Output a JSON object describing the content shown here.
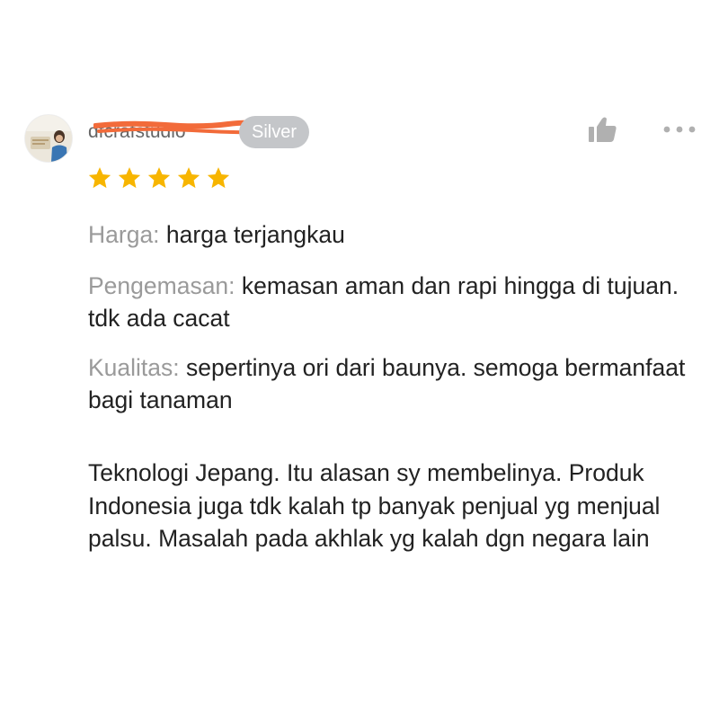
{
  "reviewer": {
    "username": "dfcrafstudio",
    "badge": "Silver"
  },
  "rating": {
    "stars": 5,
    "max": 5,
    "star_color": "#f7b500"
  },
  "fields": [
    {
      "label": "Harga:",
      "value": "harga terjangkau"
    },
    {
      "label": "Pengemasan:",
      "value": "kemasan aman dan rapi hingga di tujuan. tdk ada cacat"
    },
    {
      "label": "Kualitas:",
      "value": "sepertinya ori dari baunya. semoga bermanfaat bagi tanaman"
    }
  ],
  "comment": "Teknologi Jepang. Itu alasan sy membelinya. Produk Indonesia juga tdk kalah tp banyak penjual yg menjual palsu. Masalah pada akhlak yg kalah dgn negara lain",
  "icons": {
    "like": "thumbs-up-icon",
    "more": "more-options-icon"
  },
  "colors": {
    "redaction": "#f26b3a",
    "badge_bg": "#c4c6c9",
    "label": "#9a9a9a",
    "text": "#222222",
    "icon": "#b0b0b0"
  }
}
